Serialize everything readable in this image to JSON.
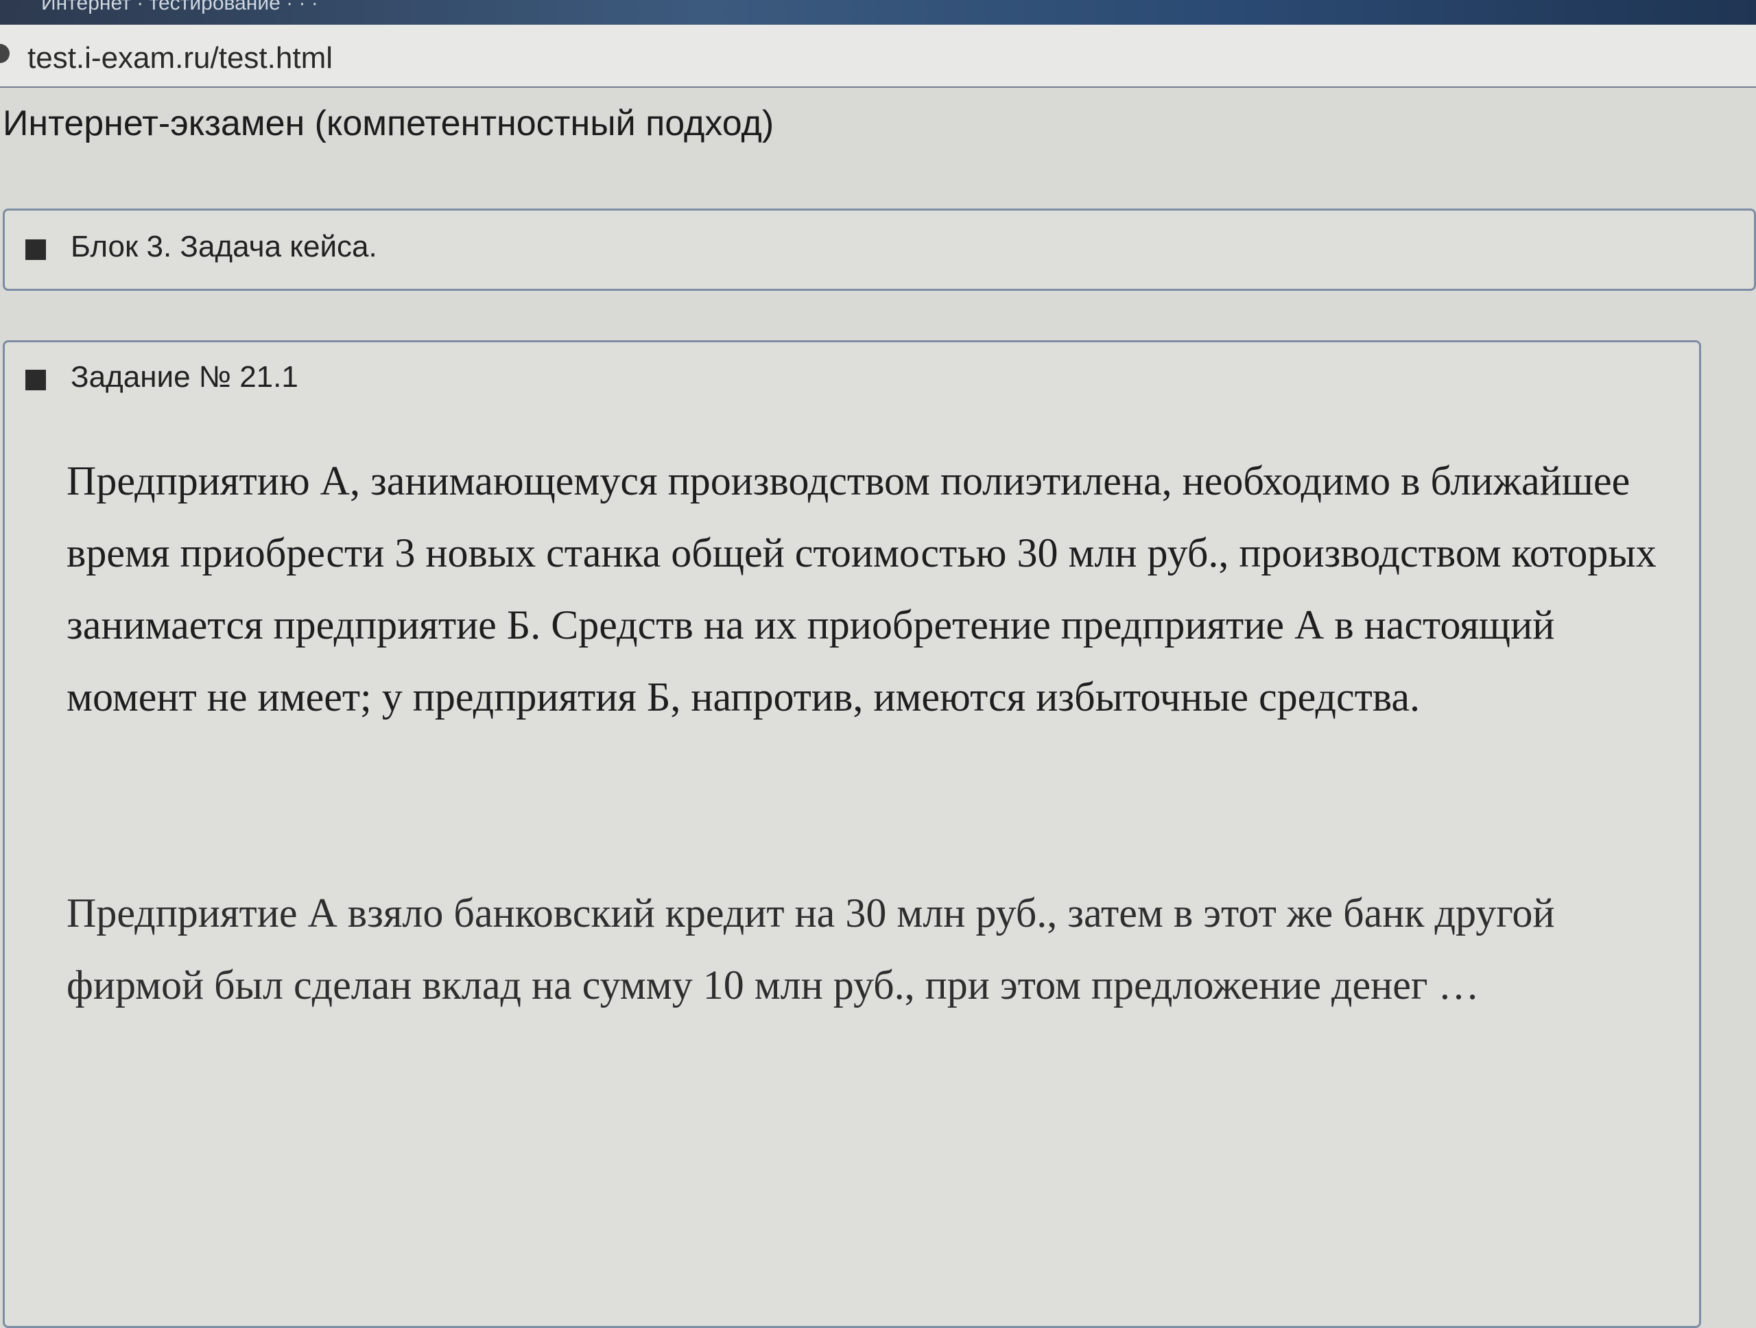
{
  "browser": {
    "url": "test.i-exam.ru/test.html"
  },
  "page": {
    "title": "Интернет-экзамен (компетентностный подход)"
  },
  "block": {
    "heading": "Блок 3. Задача кейса."
  },
  "task": {
    "heading": "Задание № 21.1",
    "paragraphs": [
      "Предприятию А, занимающемуся производством полиэтилена, необходимо в ближайшее время приобрести 3 новых станка общей стоимостью 30 млн руб., производством которых занимается предприятие Б. Средств на их приобретение предприятие А в настоящий момент не имеет; у предприятия Б, напротив, имеются избыточные средства.",
      "Предприятие А взяло банковский кредит на 30 млн руб., затем в этот же банк другой фирмой был сделан вклад на сумму 10 млн руб., при этом предложение денег …"
    ]
  }
}
